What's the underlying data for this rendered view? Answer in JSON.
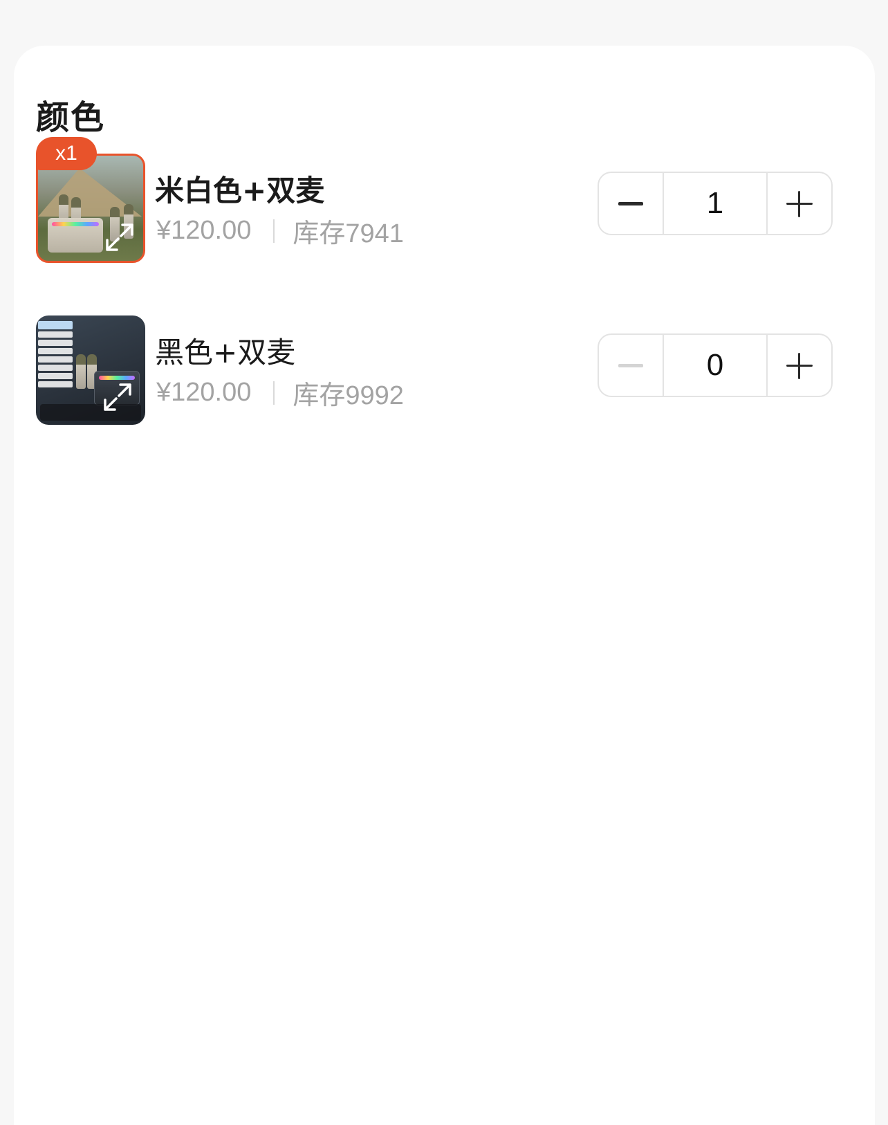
{
  "section": {
    "title": "颜色"
  },
  "skus": [
    {
      "name": "米白色+双麦",
      "price": "¥120.00",
      "stock": "库存7941",
      "quantity": "1",
      "selected": true,
      "badge": "x1",
      "thumbnail_icon": "expand-icon"
    },
    {
      "name": "黑色+双麦",
      "price": "¥120.00",
      "stock": "库存9992",
      "quantity": "0",
      "selected": false,
      "thumbnail_icon": "expand-icon"
    }
  ],
  "colors": {
    "accent": "#e8532b",
    "muted_text": "#a3a3a3",
    "border": "#e3e3e3",
    "disabled": "#d4d4d4"
  }
}
